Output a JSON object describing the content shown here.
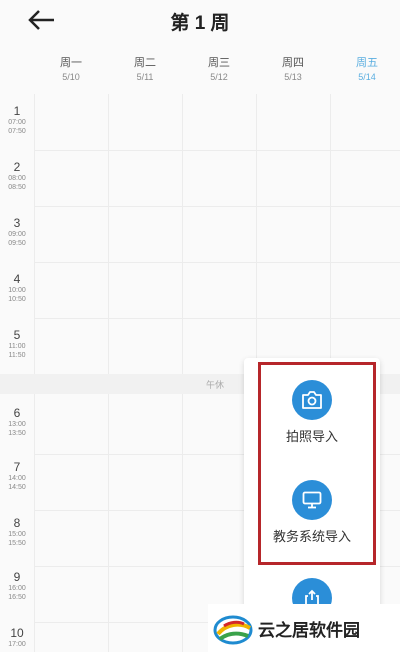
{
  "header": {
    "title": "第 1 周"
  },
  "days": [
    {
      "name": "周一",
      "date": "5/10"
    },
    {
      "name": "周二",
      "date": "5/11"
    },
    {
      "name": "周三",
      "date": "5/12"
    },
    {
      "name": "周四",
      "date": "5/13"
    },
    {
      "name": "周五",
      "date": "5/14"
    }
  ],
  "today_index": 4,
  "periods": [
    {
      "num": "1",
      "start": "07:00",
      "end": "07:50"
    },
    {
      "num": "2",
      "start": "08:00",
      "end": "08:50"
    },
    {
      "num": "3",
      "start": "09:00",
      "end": "09:50"
    },
    {
      "num": "4",
      "start": "10:00",
      "end": "10:50"
    },
    {
      "num": "5",
      "start": "11:00",
      "end": "11:50"
    },
    {
      "num": "6",
      "start": "13:00",
      "end": "13:50"
    },
    {
      "num": "7",
      "start": "14:00",
      "end": "14:50"
    },
    {
      "num": "8",
      "start": "15:00",
      "end": "15:50"
    },
    {
      "num": "9",
      "start": "16:00",
      "end": "16:50"
    },
    {
      "num": "10",
      "start": "17:00",
      "end": ""
    }
  ],
  "noon_label": "午休",
  "import_menu": {
    "photo_label": "拍照导入",
    "system_label": "教务系统导入"
  },
  "watermark": {
    "text": "云之居软件园"
  },
  "colors": {
    "accent": "#2b8ed8",
    "today": "#5aaee0",
    "highlight": "#b6262a"
  },
  "icons": [
    "back-arrow-icon",
    "camera-icon",
    "monitor-icon",
    "share-icon",
    "logo-icon"
  ]
}
